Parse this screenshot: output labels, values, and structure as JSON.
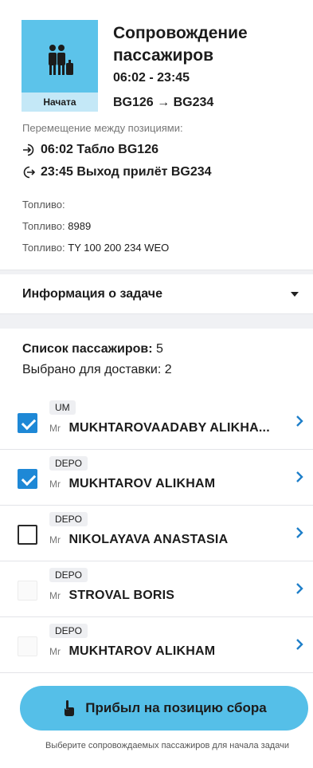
{
  "task": {
    "title": "Сопровождение пассажиров",
    "status": "Начата",
    "time_range": "06:02 - 23:45",
    "flights": "BG126 → BG234",
    "move_label": "Перемещение между позициями:",
    "move_from": "06:02 Табло BG126",
    "move_to": "23:45 Выход прилёт BG234",
    "fuel_1_label": "Топливо:",
    "fuel_2_label": "Топливо:",
    "fuel_2_value": "8989",
    "fuel_3_label": "Топливо:",
    "fuel_3_value": "TY 100 200 234 WEO",
    "thumb_color": "#5cc3ea"
  },
  "info": {
    "title": "Информация о задаче"
  },
  "passengers": {
    "count_label": "Список пассажиров:",
    "count_value": "5",
    "selected_label": "Выбрано для доставки: 2",
    "rows": [
      {
        "tag": "UM",
        "title": "Mr",
        "name": "MUKHTAROVAADABY ALIKHA...",
        "state": "checked"
      },
      {
        "tag": "DEPO",
        "title": "Mr",
        "name": "MUKHTAROV ALIKHAM",
        "state": "checked"
      },
      {
        "tag": "DEPO",
        "title": "Mr",
        "name": "NIKOLAYAVA ANASTASIA",
        "state": "unchecked"
      },
      {
        "tag": "DEPO",
        "title": "Mr",
        "name": "STROVAL BORIS",
        "state": "disabled"
      },
      {
        "tag": "DEPO",
        "title": "Mr",
        "name": "MUKHTAROV ALIKHAM",
        "state": "disabled"
      }
    ]
  },
  "action": {
    "button_label": "Прибыл на позицию сбора",
    "hint": "Выберите сопровождаемых пассажиров для начала задачи",
    "accent_color": "#55bfe8",
    "check_color": "#1e88d6",
    "arrow_color": "#1e7fc9"
  }
}
